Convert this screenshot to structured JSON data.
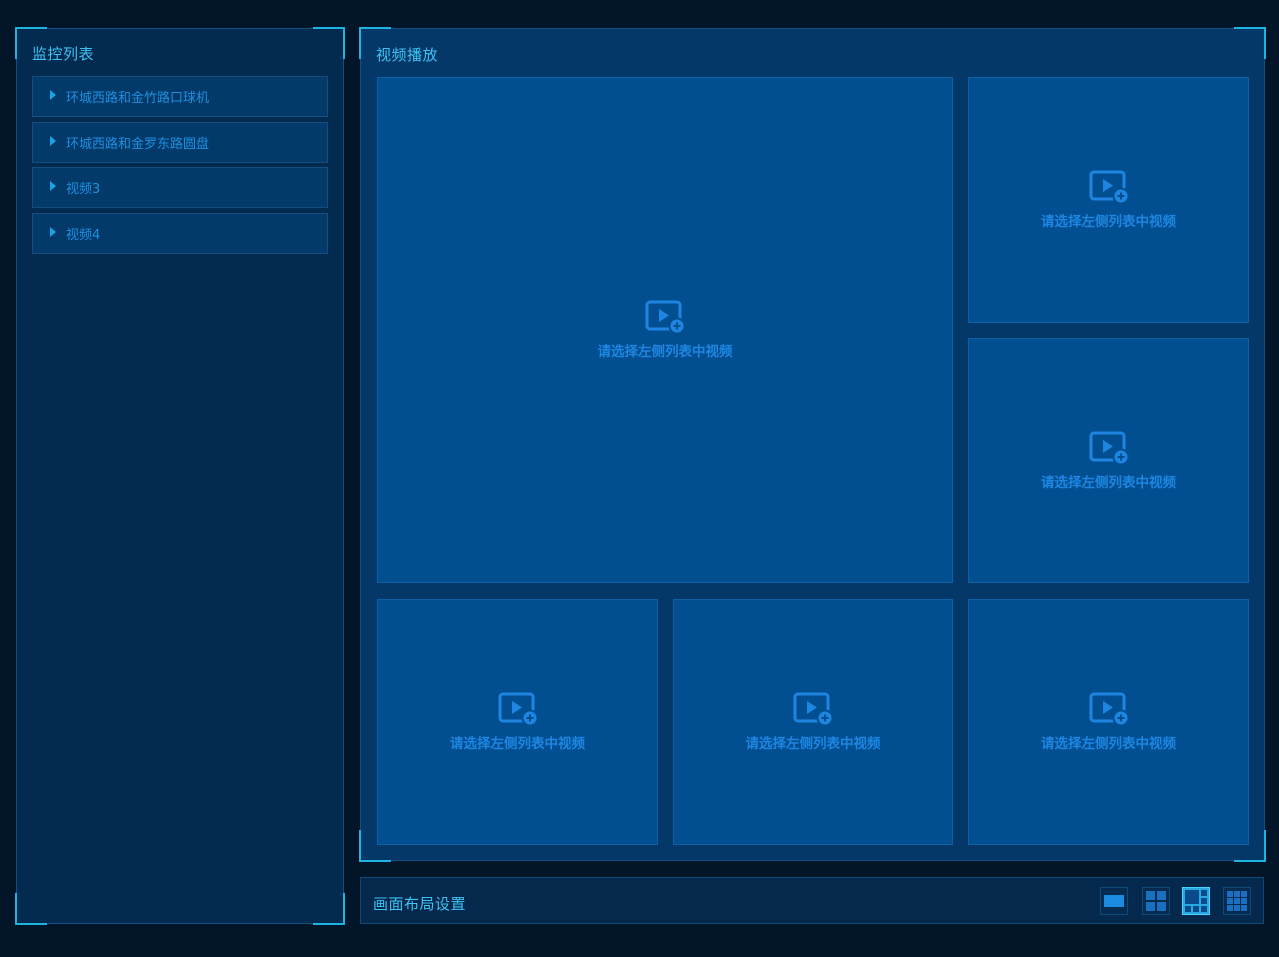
{
  "left_panel": {
    "title": "监控列表",
    "items": [
      {
        "label": "环城西路和金竹路口球机"
      },
      {
        "label": "环城西路和金罗东路圆盘"
      },
      {
        "label": "视频3"
      },
      {
        "label": "视频4"
      }
    ]
  },
  "main_panel": {
    "title": "视频播放",
    "placeholder": "请选择左侧列表中视频",
    "cells": [
      {
        "icon": "video-add-icon"
      },
      {
        "icon": "video-add-icon"
      },
      {
        "icon": "video-add-icon"
      },
      {
        "icon": "video-add-icon"
      },
      {
        "icon": "video-add-icon"
      },
      {
        "icon": "video-add-icon"
      }
    ]
  },
  "layout_bar": {
    "title": "画面布局设置",
    "options": [
      {
        "icon": "layout-1-icon",
        "active": false
      },
      {
        "icon": "layout-4-icon",
        "active": false
      },
      {
        "icon": "layout-6-icon",
        "active": true
      },
      {
        "icon": "layout-9-icon",
        "active": false
      }
    ]
  },
  "colors": {
    "accent": "#1fb4e0",
    "background": "#021529",
    "cell": "#014f91",
    "placeholder_text": "#1e86e1"
  }
}
